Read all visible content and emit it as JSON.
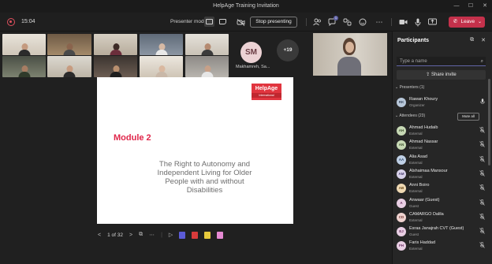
{
  "window": {
    "title": "HelpAge Training Invitation",
    "controls": [
      "—",
      "☐",
      "✕"
    ]
  },
  "toolbar": {
    "timer": "15:04",
    "presenter_mode_label": "Presenter mode",
    "stop_presenting_label": "Stop presenting",
    "leave_label": "Leave",
    "chat_badge": "1"
  },
  "stage": {
    "avatar_initials": "SM",
    "avatar_name": "Makhamreh, Sa...",
    "more_label": "+19"
  },
  "slide": {
    "logo_text": "HelpAge",
    "logo_sub": "International",
    "heading": "Module 2",
    "body_lines": [
      "The Right to Autonomy and",
      "Independent Living for Older",
      "People with and without",
      "Disabilities"
    ]
  },
  "slidebar": {
    "page_indicator": "1 of 32"
  },
  "participants": {
    "title": "Participants",
    "search_placeholder": "Type a name",
    "share_invite_label": "Share invite",
    "presenters_section": "Presenters (1)",
    "attendees_section": "Attendees (23)",
    "mute_all_label": "Mute all",
    "presenters": [
      {
        "initials": "RK",
        "name": "Rawan Khoury",
        "role": "Organizer",
        "avatar_color": "#b8c7d9",
        "text_color": "#3b4b60"
      }
    ],
    "attendees": [
      {
        "initials": "AH",
        "name": "Ahmad Hudaib",
        "role": "External",
        "avatar_color": "#c7d9b5",
        "text_color": "#3f5230"
      },
      {
        "initials": "AN",
        "name": "Ahmad Nassar",
        "role": "External",
        "avatar_color": "#c7d9b5",
        "text_color": "#3f5230"
      },
      {
        "initials": "AA",
        "name": "Alia Asad",
        "role": "External",
        "avatar_color": "#bfd0e6",
        "text_color": "#32496a"
      },
      {
        "initials": "AM",
        "name": "Alshaimaa Mansour",
        "role": "External",
        "avatar_color": "#d8d2ea",
        "text_color": "#4a3f70"
      },
      {
        "initials": "AB",
        "name": "Anni Boiro",
        "role": "External",
        "avatar_color": "#efd9b3",
        "text_color": "#6a4a1a"
      },
      {
        "initials": "A",
        "name": "Anwaar (Guest)",
        "role": "Guest",
        "avatar_color": "#e9cfe4",
        "text_color": "#6a2e61"
      },
      {
        "initials": "CD",
        "name": "CAMARGO Dalila",
        "role": "External",
        "avatar_color": "#f0d3d0",
        "text_color": "#6e3530"
      },
      {
        "initials": "EJ",
        "name": "Esraa Janajrah CVT (Guest)",
        "role": "Guest",
        "avatar_color": "#e9cfe4",
        "text_color": "#6a2e61"
      },
      {
        "initials": "FH",
        "name": "Faris Haddad",
        "role": "External",
        "avatar_color": "#e9cfe4",
        "text_color": "#6a2e61"
      }
    ]
  },
  "colors": {
    "accent": "#6264a7",
    "leave": "#c4314b",
    "module_heading": "#e0264a",
    "logo": "#e1353f"
  }
}
